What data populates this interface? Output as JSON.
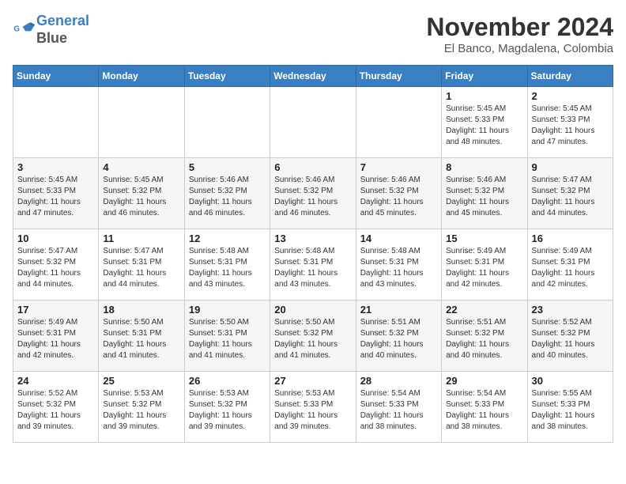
{
  "header": {
    "logo_line1": "General",
    "logo_line2": "Blue",
    "month": "November 2024",
    "location": "El Banco, Magdalena, Colombia"
  },
  "weekdays": [
    "Sunday",
    "Monday",
    "Tuesday",
    "Wednesday",
    "Thursday",
    "Friday",
    "Saturday"
  ],
  "weeks": [
    [
      {
        "day": "",
        "info": ""
      },
      {
        "day": "",
        "info": ""
      },
      {
        "day": "",
        "info": ""
      },
      {
        "day": "",
        "info": ""
      },
      {
        "day": "",
        "info": ""
      },
      {
        "day": "1",
        "info": "Sunrise: 5:45 AM\nSunset: 5:33 PM\nDaylight: 11 hours and 48 minutes."
      },
      {
        "day": "2",
        "info": "Sunrise: 5:45 AM\nSunset: 5:33 PM\nDaylight: 11 hours and 47 minutes."
      }
    ],
    [
      {
        "day": "3",
        "info": "Sunrise: 5:45 AM\nSunset: 5:33 PM\nDaylight: 11 hours and 47 minutes."
      },
      {
        "day": "4",
        "info": "Sunrise: 5:45 AM\nSunset: 5:32 PM\nDaylight: 11 hours and 46 minutes."
      },
      {
        "day": "5",
        "info": "Sunrise: 5:46 AM\nSunset: 5:32 PM\nDaylight: 11 hours and 46 minutes."
      },
      {
        "day": "6",
        "info": "Sunrise: 5:46 AM\nSunset: 5:32 PM\nDaylight: 11 hours and 46 minutes."
      },
      {
        "day": "7",
        "info": "Sunrise: 5:46 AM\nSunset: 5:32 PM\nDaylight: 11 hours and 45 minutes."
      },
      {
        "day": "8",
        "info": "Sunrise: 5:46 AM\nSunset: 5:32 PM\nDaylight: 11 hours and 45 minutes."
      },
      {
        "day": "9",
        "info": "Sunrise: 5:47 AM\nSunset: 5:32 PM\nDaylight: 11 hours and 44 minutes."
      }
    ],
    [
      {
        "day": "10",
        "info": "Sunrise: 5:47 AM\nSunset: 5:32 PM\nDaylight: 11 hours and 44 minutes."
      },
      {
        "day": "11",
        "info": "Sunrise: 5:47 AM\nSunset: 5:31 PM\nDaylight: 11 hours and 44 minutes."
      },
      {
        "day": "12",
        "info": "Sunrise: 5:48 AM\nSunset: 5:31 PM\nDaylight: 11 hours and 43 minutes."
      },
      {
        "day": "13",
        "info": "Sunrise: 5:48 AM\nSunset: 5:31 PM\nDaylight: 11 hours and 43 minutes."
      },
      {
        "day": "14",
        "info": "Sunrise: 5:48 AM\nSunset: 5:31 PM\nDaylight: 11 hours and 43 minutes."
      },
      {
        "day": "15",
        "info": "Sunrise: 5:49 AM\nSunset: 5:31 PM\nDaylight: 11 hours and 42 minutes."
      },
      {
        "day": "16",
        "info": "Sunrise: 5:49 AM\nSunset: 5:31 PM\nDaylight: 11 hours and 42 minutes."
      }
    ],
    [
      {
        "day": "17",
        "info": "Sunrise: 5:49 AM\nSunset: 5:31 PM\nDaylight: 11 hours and 42 minutes."
      },
      {
        "day": "18",
        "info": "Sunrise: 5:50 AM\nSunset: 5:31 PM\nDaylight: 11 hours and 41 minutes."
      },
      {
        "day": "19",
        "info": "Sunrise: 5:50 AM\nSunset: 5:31 PM\nDaylight: 11 hours and 41 minutes."
      },
      {
        "day": "20",
        "info": "Sunrise: 5:50 AM\nSunset: 5:32 PM\nDaylight: 11 hours and 41 minutes."
      },
      {
        "day": "21",
        "info": "Sunrise: 5:51 AM\nSunset: 5:32 PM\nDaylight: 11 hours and 40 minutes."
      },
      {
        "day": "22",
        "info": "Sunrise: 5:51 AM\nSunset: 5:32 PM\nDaylight: 11 hours and 40 minutes."
      },
      {
        "day": "23",
        "info": "Sunrise: 5:52 AM\nSunset: 5:32 PM\nDaylight: 11 hours and 40 minutes."
      }
    ],
    [
      {
        "day": "24",
        "info": "Sunrise: 5:52 AM\nSunset: 5:32 PM\nDaylight: 11 hours and 39 minutes."
      },
      {
        "day": "25",
        "info": "Sunrise: 5:53 AM\nSunset: 5:32 PM\nDaylight: 11 hours and 39 minutes."
      },
      {
        "day": "26",
        "info": "Sunrise: 5:53 AM\nSunset: 5:32 PM\nDaylight: 11 hours and 39 minutes."
      },
      {
        "day": "27",
        "info": "Sunrise: 5:53 AM\nSunset: 5:33 PM\nDaylight: 11 hours and 39 minutes."
      },
      {
        "day": "28",
        "info": "Sunrise: 5:54 AM\nSunset: 5:33 PM\nDaylight: 11 hours and 38 minutes."
      },
      {
        "day": "29",
        "info": "Sunrise: 5:54 AM\nSunset: 5:33 PM\nDaylight: 11 hours and 38 minutes."
      },
      {
        "day": "30",
        "info": "Sunrise: 5:55 AM\nSunset: 5:33 PM\nDaylight: 11 hours and 38 minutes."
      }
    ]
  ]
}
